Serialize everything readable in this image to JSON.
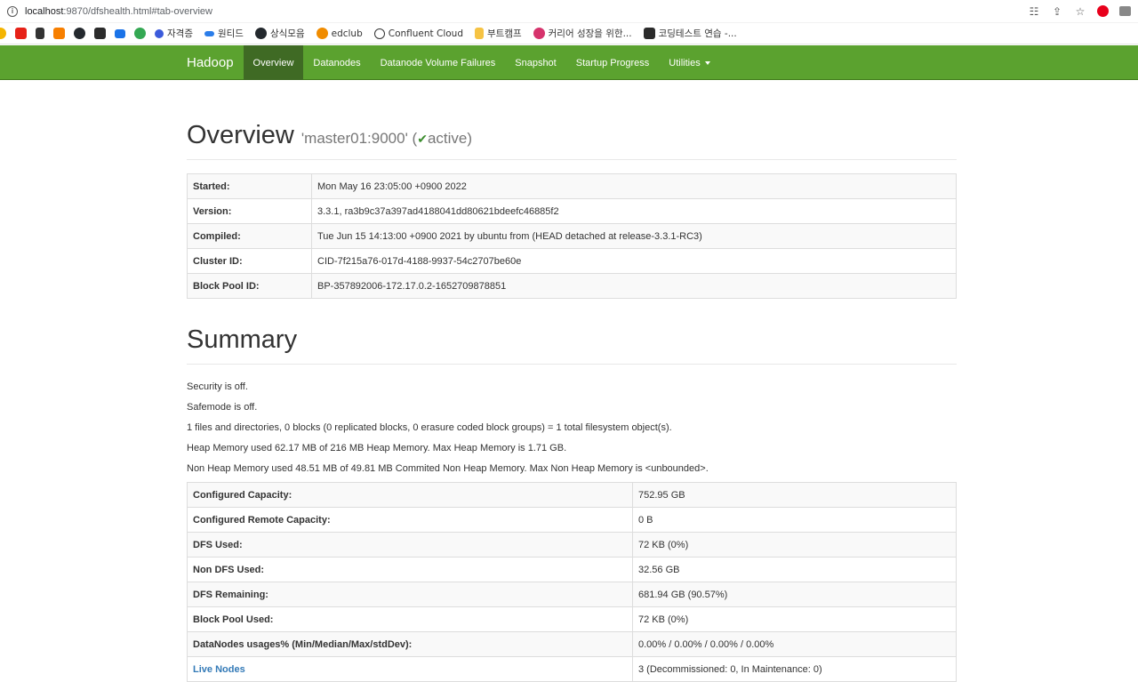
{
  "browser": {
    "url_host": "localhost",
    "url_rest": ":9870/dfshealth.html#tab-overview",
    "bookmarks": [
      "자격증",
      "원티드",
      "상식모음",
      "edclub",
      "Confluent Cloud",
      "부트캠프",
      "커리어 성장을 위한...",
      "코딩테스트 연습 -..."
    ]
  },
  "navbar": {
    "brand": "Hadoop",
    "links": [
      "Overview",
      "Datanodes",
      "Datanode Volume Failures",
      "Snapshot",
      "Startup Progress",
      "Utilities"
    ]
  },
  "overview": {
    "title": "Overview",
    "host": "'master01:9000'",
    "status": "active",
    "rows": [
      {
        "key": "Started:",
        "value": "Mon May 16 23:05:00 +0900 2022"
      },
      {
        "key": "Version:",
        "value": "3.3.1, ra3b9c37a397ad4188041dd80621bdeefc46885f2"
      },
      {
        "key": "Compiled:",
        "value": "Tue Jun 15 14:13:00 +0900 2021 by ubuntu from (HEAD detached at release-3.3.1-RC3)"
      },
      {
        "key": "Cluster ID:",
        "value": "CID-7f215a76-017d-4188-9937-54c2707be60e"
      },
      {
        "key": "Block Pool ID:",
        "value": "BP-357892006-172.17.0.2-1652709878851"
      }
    ]
  },
  "summary": {
    "title": "Summary",
    "lines": [
      "Security is off.",
      "Safemode is off.",
      "1 files and directories, 0 blocks (0 replicated blocks, 0 erasure coded block groups) = 1 total filesystem object(s).",
      "Heap Memory used 62.17 MB of 216 MB Heap Memory. Max Heap Memory is 1.71 GB.",
      "Non Heap Memory used 48.51 MB of 49.81 MB Commited Non Heap Memory. Max Non Heap Memory is <unbounded>."
    ],
    "rows": [
      {
        "key": "Configured Capacity:",
        "value": "752.95 GB"
      },
      {
        "key": "Configured Remote Capacity:",
        "value": "0 B"
      },
      {
        "key": "DFS Used:",
        "value": "72 KB (0%)"
      },
      {
        "key": "Non DFS Used:",
        "value": "32.56 GB"
      },
      {
        "key": "DFS Remaining:",
        "value": "681.94 GB (90.57%)"
      },
      {
        "key": "Block Pool Used:",
        "value": "72 KB (0%)"
      },
      {
        "key": "DataNodes usages% (Min/Median/Max/stdDev):",
        "value": "0.00% / 0.00% / 0.00% / 0.00%"
      },
      {
        "key": "Live Nodes",
        "value": "3 (Decommissioned: 0, In Maintenance: 0)"
      }
    ]
  }
}
